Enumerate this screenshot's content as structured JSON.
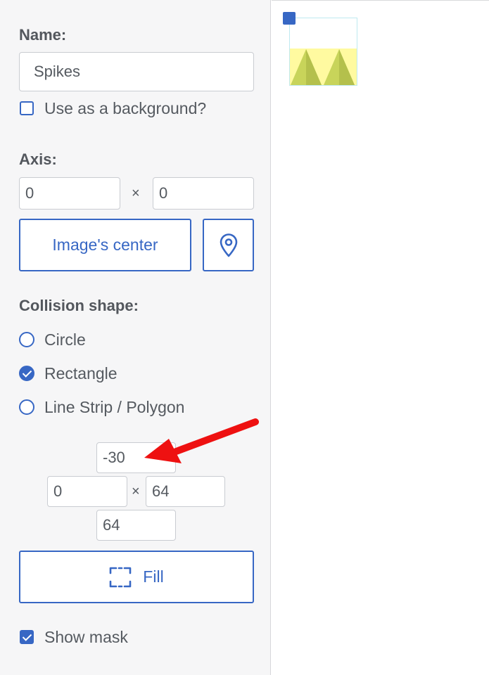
{
  "name_section": {
    "label": "Name:",
    "value": "Spikes",
    "background_checkbox_label": "Use as a background?",
    "background_checked": false
  },
  "axis_section": {
    "label": "Axis:",
    "x_value": "0",
    "separator": "×",
    "y_value": "0",
    "center_button_label": "Image's center",
    "pick_icon": "map-pin-icon"
  },
  "collision_section": {
    "label": "Collision shape:",
    "options": [
      {
        "label": "Circle",
        "selected": false
      },
      {
        "label": "Rectangle",
        "selected": true
      },
      {
        "label": "Line Strip / Polygon",
        "selected": false
      }
    ],
    "top_value": "-30",
    "left_value": "0",
    "separator": "×",
    "right_value": "64",
    "bottom_value": "64",
    "fill_button_label": "Fill",
    "fill_icon": "fill-frame-icon",
    "show_mask_label": "Show mask",
    "show_mask_checked": true
  },
  "colors": {
    "accent": "#3767c4",
    "annotation_arrow": "#ee1111",
    "sprite_yellow": "#fffaa0",
    "sprite_spikes": "#c8d45a",
    "mask_outline": "#bfe9f0"
  },
  "canvas": {
    "sprite_name": "spikes-sprite"
  }
}
